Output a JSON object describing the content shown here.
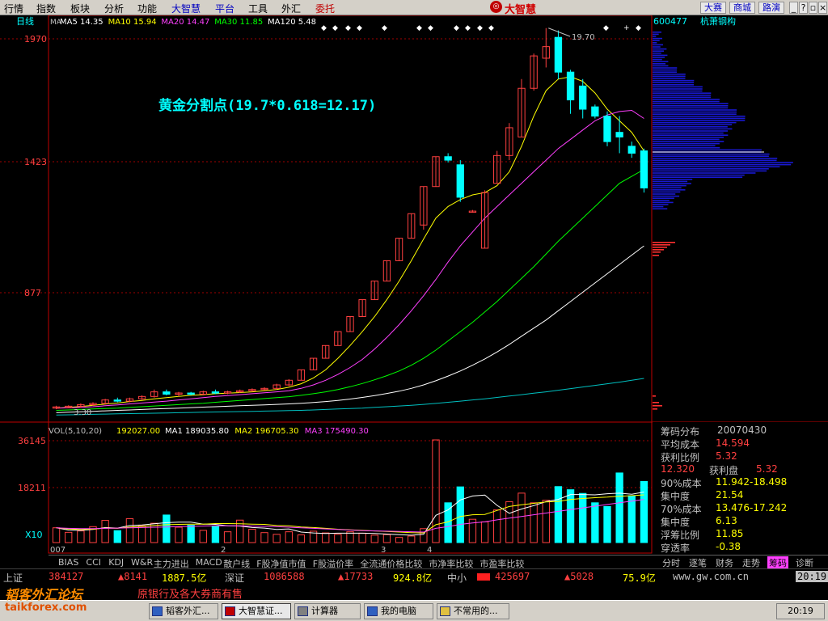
{
  "menu": [
    "行情",
    "指数",
    "板块",
    "分析",
    "功能",
    "大智慧",
    "平台",
    "工具",
    "外汇",
    "委托"
  ],
  "menu_colors": {
    "highlight": "#0000c0",
    "alert": "#c00000"
  },
  "logo_text": "大智慧",
  "top_buttons": [
    "大赛",
    "商城",
    "路演"
  ],
  "window_controls": [
    "minimize-icon",
    "help-icon",
    "restore-icon",
    "close-icon"
  ],
  "chart_header": {
    "period": "日线",
    "ma_label": "MA",
    "ma": [
      {
        "name": "MA5",
        "value": "14.35",
        "color": "#ffffff"
      },
      {
        "name": "MA10",
        "value": "15.94",
        "color": "#ffff00"
      },
      {
        "name": "MA20",
        "value": "14.47",
        "color": "#ff40ff"
      },
      {
        "name": "MA30",
        "value": "11.85",
        "color": "#00ff00"
      },
      {
        "name": "MA120",
        "value": "5.48",
        "color": "#ffffff"
      }
    ],
    "ma_colors_map": {
      "MA5": "#ffffff",
      "MA10": "#ffff00",
      "MA20": "#ff40ff",
      "MA30": "#00ff00",
      "MA120": "#00c0c0"
    }
  },
  "annotation": "黄金分割点(19.7*0.618=12.17)",
  "stock": {
    "code": "600477",
    "name": "杭萧钢构"
  },
  "vol_header": {
    "label": "VOL(5,10,20)",
    "vol": "192027.00",
    "items": [
      {
        "name": "MA1",
        "value": "189035.80",
        "color": "#ffffff"
      },
      {
        "name": "MA2",
        "value": "196705.30",
        "color": "#ffff00"
      },
      {
        "name": "MA3",
        "value": "175490.30",
        "color": "#ff40ff"
      }
    ]
  },
  "chips": {
    "title": "筹码分布",
    "date": "20070430",
    "rows": [
      {
        "label": "平均成本",
        "value": "14.594",
        "color": "#ff4040"
      },
      {
        "label": "获利比例",
        "value": "5.32",
        "color": "#ff4040"
      },
      {
        "label": "12.320",
        "value2_label": "获利盘",
        "value": "5.32",
        "color": "#ff4040"
      },
      {
        "label": "90%成本",
        "value": "11.942-18.498",
        "color": "#ffff00"
      },
      {
        "label": "集中度",
        "value": "21.54",
        "color": "#ffff00"
      },
      {
        "label": "70%成本",
        "value": "13.476-17.242",
        "color": "#ffff00"
      },
      {
        "label": "集中度",
        "value": "6.13",
        "color": "#ffff00"
      },
      {
        "label": "浮筹比例",
        "value": "11.85",
        "color": "#ffff00"
      },
      {
        "label": "穿透率",
        "value": "-0.38",
        "color": "#ffff00"
      }
    ]
  },
  "indicator_tabs": [
    "BIAS",
    "CCI",
    "KDJ",
    "W&R",
    "主力进出",
    "MACD",
    "散户线",
    "F股净值市值",
    "F股溢价率",
    "全流通价格比较",
    "市净率比较",
    "市盈率比较"
  ],
  "right_tabs": [
    "分时",
    "逐笔",
    "财务",
    "走势",
    "筹码",
    "诊断"
  ],
  "right_tab_active": "筹码",
  "ticker": {
    "sh_label": "上证",
    "sh_value": "384127",
    "sh_change": "▲8141",
    "sh_amount": "1887.5亿",
    "sz_label": "深证",
    "sz_value": "1086588",
    "sz_change": "▲17733",
    "sz_amount": "924.8亿",
    "zx_label": "中小",
    "zx_value": "425697",
    "zx_change": "▲5028",
    "zx_amount": "75.9亿",
    "site": "www.gw.com.cn",
    "time": "20:19"
  },
  "scroll_text": "原银行及各大券商有售",
  "watermark": {
    "line1": "韬客外汇论坛",
    "line2": "taikforex.com"
  },
  "taskbar": {
    "tasks": [
      "韬客外汇...",
      "大智慧证...",
      "计算器",
      "我的电脑",
      "不常用的..."
    ],
    "clock": "20:19"
  },
  "chart_data": {
    "type": "candlestick",
    "title": "",
    "y_ticks_price": [
      "1970",
      "1423",
      "877"
    ],
    "y_ticks_volume": [
      "36145",
      "18211",
      "X10"
    ],
    "x_labels": [
      "007",
      "2",
      "3",
      "4"
    ],
    "price_labels": [
      {
        "text": "19.70"
      },
      {
        "text": "3.30"
      }
    ],
    "ylim_price": [
      2.8,
      19.9
    ],
    "ylim_volume": [
      0,
      36145
    ],
    "candles": [
      {
        "o": 3.3,
        "h": 3.4,
        "l": 3.25,
        "c": 3.35
      },
      {
        "o": 3.35,
        "h": 3.42,
        "l": 3.3,
        "c": 3.38
      },
      {
        "o": 3.38,
        "h": 3.5,
        "l": 3.32,
        "c": 3.45
      },
      {
        "o": 3.45,
        "h": 3.55,
        "l": 3.4,
        "c": 3.5
      },
      {
        "o": 3.5,
        "h": 3.7,
        "l": 3.45,
        "c": 3.65
      },
      {
        "o": 3.65,
        "h": 3.75,
        "l": 3.55,
        "c": 3.6
      },
      {
        "o": 3.6,
        "h": 3.75,
        "l": 3.55,
        "c": 3.7
      },
      {
        "o": 3.7,
        "h": 3.85,
        "l": 3.65,
        "c": 3.8
      },
      {
        "o": 3.8,
        "h": 4.1,
        "l": 3.75,
        "c": 4.0
      },
      {
        "o": 4.0,
        "h": 4.1,
        "l": 3.85,
        "c": 3.9
      },
      {
        "o": 3.9,
        "h": 4.0,
        "l": 3.8,
        "c": 3.95
      },
      {
        "o": 3.95,
        "h": 4.0,
        "l": 3.85,
        "c": 3.9
      },
      {
        "o": 3.9,
        "h": 4.05,
        "l": 3.85,
        "c": 4.0
      },
      {
        "o": 4.0,
        "h": 4.1,
        "l": 3.9,
        "c": 3.95
      },
      {
        "o": 3.95,
        "h": 4.05,
        "l": 3.9,
        "c": 4.0
      },
      {
        "o": 4.0,
        "h": 4.1,
        "l": 3.95,
        "c": 4.05
      },
      {
        "o": 4.05,
        "h": 4.15,
        "l": 4.0,
        "c": 4.1
      },
      {
        "o": 4.1,
        "h": 4.2,
        "l": 4.05,
        "c": 4.15
      },
      {
        "o": 4.15,
        "h": 4.35,
        "l": 4.1,
        "c": 4.3
      },
      {
        "o": 4.3,
        "h": 4.55,
        "l": 4.25,
        "c": 4.5
      },
      {
        "o": 4.5,
        "h": 4.95,
        "l": 4.5,
        "c": 4.95
      },
      {
        "o": 4.95,
        "h": 5.45,
        "l": 4.95,
        "c": 5.45
      },
      {
        "o": 5.45,
        "h": 6.0,
        "l": 5.45,
        "c": 6.0
      },
      {
        "o": 6.0,
        "h": 6.6,
        "l": 6.0,
        "c": 6.6
      },
      {
        "o": 6.6,
        "h": 7.25,
        "l": 6.6,
        "c": 7.25
      },
      {
        "o": 7.25,
        "h": 7.98,
        "l": 7.25,
        "c": 7.98
      },
      {
        "o": 7.98,
        "h": 8.78,
        "l": 7.98,
        "c": 8.78
      },
      {
        "o": 8.78,
        "h": 9.66,
        "l": 8.78,
        "c": 9.66
      },
      {
        "o": 9.66,
        "h": 10.63,
        "l": 9.66,
        "c": 10.63
      },
      {
        "o": 10.63,
        "h": 11.69,
        "l": 10.63,
        "c": 11.69
      },
      {
        "o": 11.2,
        "h": 12.86,
        "l": 11.0,
        "c": 12.86
      },
      {
        "o": 12.86,
        "h": 14.15,
        "l": 12.86,
        "c": 14.15
      },
      {
        "o": 14.15,
        "h": 14.3,
        "l": 13.9,
        "c": 14.0
      },
      {
        "o": 13.8,
        "h": 14.0,
        "l": 12.2,
        "c": 12.4
      },
      {
        "o": 11.8,
        "h": 11.85,
        "l": 11.75,
        "c": 11.8
      },
      {
        "o": 10.2,
        "h": 12.7,
        "l": 10.2,
        "c": 12.6
      },
      {
        "o": 13.0,
        "h": 14.4,
        "l": 13.0,
        "c": 14.2
      },
      {
        "o": 14.2,
        "h": 15.6,
        "l": 14.0,
        "c": 15.4
      },
      {
        "o": 15.0,
        "h": 17.5,
        "l": 15.0,
        "c": 17.1
      },
      {
        "o": 17.1,
        "h": 18.6,
        "l": 17.0,
        "c": 18.5
      },
      {
        "o": 18.4,
        "h": 19.7,
        "l": 18.0,
        "c": 18.9
      },
      {
        "o": 19.3,
        "h": 19.6,
        "l": 17.5,
        "c": 17.8
      },
      {
        "o": 17.8,
        "h": 17.9,
        "l": 16.0,
        "c": 16.6
      },
      {
        "o": 17.2,
        "h": 17.5,
        "l": 15.8,
        "c": 16.2
      },
      {
        "o": 16.3,
        "h": 16.4,
        "l": 15.8,
        "c": 15.9
      },
      {
        "o": 15.9,
        "h": 16.1,
        "l": 14.6,
        "c": 14.8
      },
      {
        "o": 15.2,
        "h": 15.9,
        "l": 14.3,
        "c": 15.0
      },
      {
        "o": 14.6,
        "h": 14.8,
        "l": 14.1,
        "c": 14.3
      },
      {
        "o": 14.4,
        "h": 14.5,
        "l": 12.6,
        "c": 12.8
      }
    ],
    "ma_lines": [
      {
        "name": "MA5",
        "color": "#ffff00",
        "values": [
          3.3,
          3.33,
          3.37,
          3.42,
          3.47,
          3.52,
          3.58,
          3.63,
          3.7,
          3.75,
          3.8,
          3.85,
          3.88,
          3.92,
          3.94,
          3.97,
          4.0,
          4.05,
          4.1,
          4.2,
          4.35,
          4.6,
          4.95,
          5.45,
          6.0,
          6.6,
          7.25,
          7.98,
          8.78,
          9.66,
          10.6,
          11.5,
          12.0,
          12.3,
          12.5,
          12.6,
          12.9,
          13.5,
          14.6,
          15.9,
          17.0,
          17.5,
          17.6,
          17.4,
          16.9,
          16.2,
          15.7,
          15.2,
          14.4
        ]
      },
      {
        "name": "MA10",
        "color": "#ff40ff",
        "values": [
          3.3,
          3.31,
          3.33,
          3.36,
          3.4,
          3.44,
          3.48,
          3.52,
          3.56,
          3.6,
          3.65,
          3.7,
          3.75,
          3.8,
          3.84,
          3.88,
          3.92,
          3.96,
          4.0,
          4.05,
          4.15,
          4.3,
          4.5,
          4.75,
          5.05,
          5.4,
          5.85,
          6.35,
          6.9,
          7.5,
          8.15,
          8.85,
          9.6,
          10.3,
          10.9,
          11.5,
          12.0,
          12.5,
          13.0,
          13.5,
          14.0,
          14.5,
          14.9,
          15.3,
          15.7,
          15.95,
          16.1,
          16.15,
          15.8
        ]
      },
      {
        "name": "MA20",
        "color": "#00ff00",
        "values": [
          3.2,
          3.22,
          3.24,
          3.26,
          3.28,
          3.3,
          3.33,
          3.36,
          3.39,
          3.42,
          3.45,
          3.48,
          3.51,
          3.55,
          3.59,
          3.63,
          3.67,
          3.71,
          3.75,
          3.79,
          3.85,
          3.92,
          4.0,
          4.1,
          4.22,
          4.36,
          4.52,
          4.7,
          4.9,
          5.15,
          5.45,
          5.8,
          6.2,
          6.6,
          7.0,
          7.45,
          7.9,
          8.4,
          8.9,
          9.4,
          9.95,
          10.5,
          11.0,
          11.5,
          12.0,
          12.5,
          13.0,
          13.3,
          13.6
        ]
      },
      {
        "name": "MA30",
        "color": "#ffffff",
        "values": [
          3.1,
          3.12,
          3.14,
          3.16,
          3.18,
          3.2,
          3.22,
          3.24,
          3.26,
          3.28,
          3.3,
          3.32,
          3.34,
          3.36,
          3.38,
          3.4,
          3.42,
          3.44,
          3.46,
          3.48,
          3.51,
          3.54,
          3.58,
          3.63,
          3.69,
          3.76,
          3.84,
          3.93,
          4.03,
          4.15,
          4.3,
          4.48,
          4.68,
          4.9,
          5.15,
          5.42,
          5.72,
          6.05,
          6.4,
          6.75,
          7.1,
          7.5,
          7.9,
          8.3,
          8.7,
          9.1,
          9.5,
          9.9,
          10.3
        ]
      },
      {
        "name": "MA120",
        "color": "#00c0c0",
        "values": [
          3.0,
          3.01,
          3.02,
          3.03,
          3.04,
          3.05,
          3.06,
          3.07,
          3.08,
          3.09,
          3.1,
          3.11,
          3.12,
          3.13,
          3.14,
          3.15,
          3.16,
          3.17,
          3.18,
          3.19,
          3.2,
          3.22,
          3.24,
          3.26,
          3.28,
          3.3,
          3.33,
          3.36,
          3.39,
          3.42,
          3.46,
          3.5,
          3.55,
          3.6,
          3.65,
          3.7,
          3.76,
          3.82,
          3.88,
          3.94,
          4.0,
          4.07,
          4.14,
          4.21,
          4.28,
          4.35,
          4.42,
          4.5,
          4.58
        ]
      }
    ],
    "volume": [
      5200,
      3600,
      4100,
      5600,
      7800,
      4200,
      8400,
      5900,
      6800,
      9700,
      5400,
      6100,
      4300,
      5800,
      3800,
      7900,
      4700,
      3500,
      2900,
      3800,
      2700,
      4000,
      3400,
      2900,
      3800,
      3300,
      2600,
      2800,
      1800,
      2300,
      4900,
      36145,
      14000,
      19600,
      8200,
      7300,
      11500,
      14400,
      17400,
      14000,
      14900,
      19700,
      18600,
      17300,
      14000,
      12700,
      24500,
      16500,
      21500
    ],
    "vol_ma": [
      {
        "name": "MA1",
        "color": "#ffffff",
        "values": [
          5200,
          4400,
          4300,
          4600,
          5300,
          5100,
          6000,
          6200,
          6600,
          7000,
          7200,
          7200,
          6500,
          6400,
          5900,
          5800,
          5300,
          5100,
          4600,
          4800,
          3700,
          3400,
          3200,
          3300,
          3300,
          3300,
          3200,
          3000,
          2800,
          2600,
          2900,
          9600,
          11500,
          15000,
          16400,
          16700,
          13100,
          10300,
          11800,
          13000,
          14400,
          15200,
          16900,
          16900,
          16800,
          17200,
          17400,
          17000,
          17800
        ]
      },
      {
        "name": "MA2",
        "color": "#ffff00",
        "values": [
          5200,
          4800,
          4600,
          4700,
          5100,
          5000,
          5500,
          5700,
          6000,
          6300,
          6400,
          6500,
          6500,
          6700,
          6700,
          6600,
          6500,
          6400,
          6000,
          5900,
          5500,
          5300,
          5000,
          4700,
          4500,
          4300,
          4100,
          3900,
          3700,
          3500,
          3400,
          6300,
          7300,
          9200,
          9800,
          9900,
          11300,
          12700,
          13300,
          13800,
          14300,
          14500,
          15200,
          15500,
          15800,
          16000,
          16300,
          16500,
          16800
        ]
      },
      {
        "name": "MA3",
        "color": "#ff40ff",
        "values": [
          5200,
          5000,
          4900,
          4900,
          5000,
          5100,
          5200,
          5300,
          5400,
          5500,
          5600,
          5700,
          5800,
          5900,
          5900,
          5900,
          5800,
          5700,
          5600,
          5400,
          5200,
          5000,
          4800,
          4600,
          4400,
          4200,
          4100,
          4000,
          3900,
          3800,
          3700,
          5000,
          5600,
          6400,
          6900,
          7300,
          8000,
          8600,
          9200,
          9800,
          10400,
          11000,
          11600,
          12200,
          12800,
          13400,
          14000,
          14600,
          15200
        ]
      }
    ],
    "chip_profile_note": "price-distribution histogram"
  }
}
